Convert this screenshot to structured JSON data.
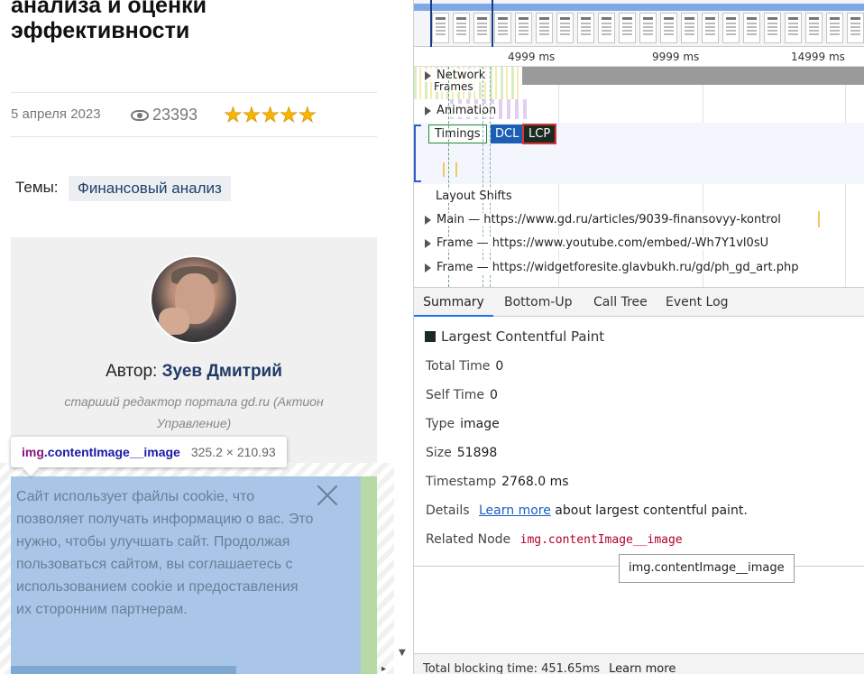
{
  "article": {
    "title": "анализа и оценки эффективности",
    "date": "5 апреля 2023",
    "views": "23393",
    "rating_stars": 5,
    "topics_label": "Темы:",
    "topic_tag": "Финансовый анализ"
  },
  "author": {
    "prefix": "Автор:",
    "name": "Зуев Дмитрий",
    "role": "старший редактор портала gd.ru (Актион Управление)"
  },
  "element_tooltip": {
    "tag": "img",
    "class": ".contentImage__image",
    "size": "325.2 × 210.93"
  },
  "cookie": {
    "text": "Сайт использует файлы cookie, что позволяет получать информацию о вас. Это нужно, чтобы улучшать сайт. Продолжая пользоваться сайтом, вы соглашаетесь с использованием cookie и предоставления их сторонним партнерам."
  },
  "timeline": {
    "ruler": [
      "4999 ms",
      "9999 ms",
      "14999 ms"
    ],
    "tracks": {
      "network": "Network",
      "frames": "Frames",
      "animation": "Animation",
      "timings": "Timings",
      "layout_shifts": "Layout Shifts",
      "main": "Main — https://www.gd.ru/articles/9039-finansovyy-kontrol",
      "frame1": "Frame — https://www.youtube.com/embed/-Wh7Y1vl0sU",
      "frame2": "Frame — https://widgetforesite.glavbukh.ru/gd/ph_gd_art.php"
    },
    "markers": {
      "dcl": "DCL",
      "lcp": "LCP"
    }
  },
  "tabs": [
    "Summary",
    "Bottom-Up",
    "Call Tree",
    "Event Log"
  ],
  "summary": {
    "heading": "Largest Contentful Paint",
    "swatch_color": "#1b2b22",
    "total_time_label": "Total Time",
    "total_time": "0",
    "self_time_label": "Self Time",
    "self_time": "0",
    "type_label": "Type",
    "type": "image",
    "size_label": "Size",
    "size": "51898",
    "timestamp_label": "Timestamp",
    "timestamp": "2768.0 ms",
    "details_label": "Details",
    "details_link": "Learn more",
    "details_text": "about largest contentful paint.",
    "related_label": "Related Node",
    "related_node": "img.contentImage__image"
  },
  "hover_tooltip": "img.contentImage__image",
  "bottom": {
    "tbt": "Total blocking time: 451.65ms",
    "link": "Learn more"
  },
  "colors": {
    "accent": "#1a73e8",
    "lcp_border": "#dd3333",
    "dcl": "#1a5fb4",
    "highlight": "#a9c6e8"
  }
}
